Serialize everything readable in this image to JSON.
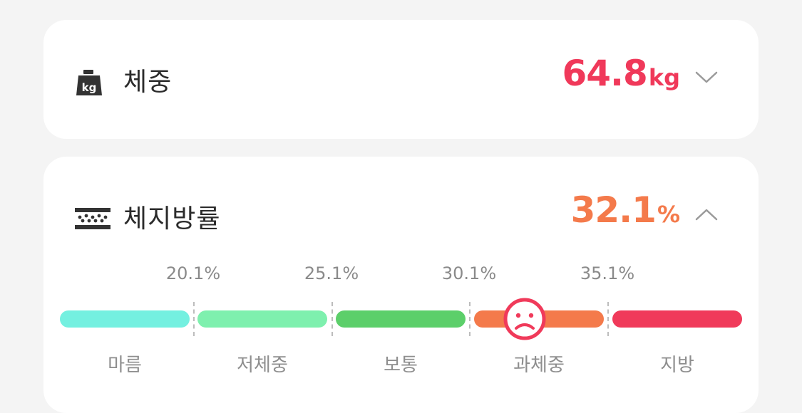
{
  "weight": {
    "label": "체중",
    "value": "64.8",
    "unit": "kg",
    "icon": "kg-weight-icon",
    "color": "#f0395a",
    "expanded": false
  },
  "body_fat": {
    "label": "체지방률",
    "value": "32.1",
    "unit": "%",
    "icon": "body-fat-layers-icon",
    "color": "#f47a4b",
    "expanded": true,
    "thresholds": [
      "20.1%",
      "25.1%",
      "30.1%",
      "35.1%"
    ],
    "categories": [
      {
        "label": "마름",
        "color": "#74f0e0"
      },
      {
        "label": "저체중",
        "color": "#7ef0ae"
      },
      {
        "label": "보통",
        "color": "#5ccf6a"
      },
      {
        "label": "과체중",
        "color": "#f47a4b"
      },
      {
        "label": "지방",
        "color": "#f03a5a"
      }
    ],
    "current_category": "과체중",
    "indicator_icon": "sad-face-icon",
    "indicator_color": "#f03a5a"
  }
}
